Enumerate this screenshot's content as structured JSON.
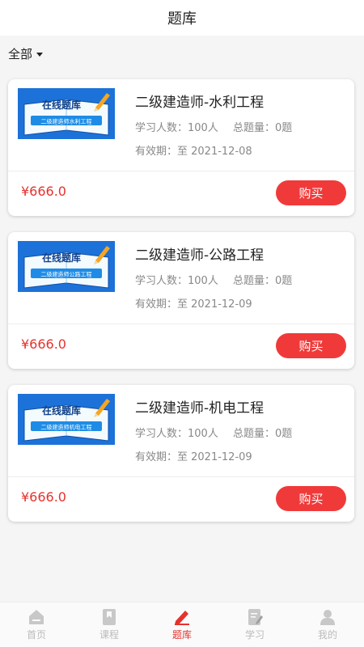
{
  "header": {
    "title": "题库"
  },
  "filter": {
    "label": "全部"
  },
  "colors": {
    "accent": "#f03a3a",
    "price": "#e5322d",
    "inactive": "#bbbbbb"
  },
  "courses": [
    {
      "thumb_title": "在线题库",
      "thumb_subtitle": "二级建造师水利工程",
      "title": "二级建造师-水利工程",
      "learners": "学习人数：100人",
      "questions": "总题量：0题",
      "validity": "有效期：至 2021-12-08",
      "price": "¥666.0",
      "buy_label": "购买"
    },
    {
      "thumb_title": "在线题库",
      "thumb_subtitle": "二级建造师公路工程",
      "title": "二级建造师-公路工程",
      "learners": "学习人数：100人",
      "questions": "总题量：0题",
      "validity": "有效期：至 2021-12-09",
      "price": "¥666.0",
      "buy_label": "购买"
    },
    {
      "thumb_title": "在线题库",
      "thumb_subtitle": "二级建造师机电工程",
      "title": "二级建造师-机电工程",
      "learners": "学习人数：100人",
      "questions": "总题量：0题",
      "validity": "有效期：至 2021-12-09",
      "price": "¥666.0",
      "buy_label": "购买"
    }
  ],
  "tabbar": [
    {
      "label": "首页",
      "icon": "home-icon",
      "active": false
    },
    {
      "label": "课程",
      "icon": "bookmark-icon",
      "active": false
    },
    {
      "label": "题库",
      "icon": "pencil-icon",
      "active": true
    },
    {
      "label": "学习",
      "icon": "notepad-icon",
      "active": false
    },
    {
      "label": "我的",
      "icon": "user-icon",
      "active": false
    }
  ]
}
